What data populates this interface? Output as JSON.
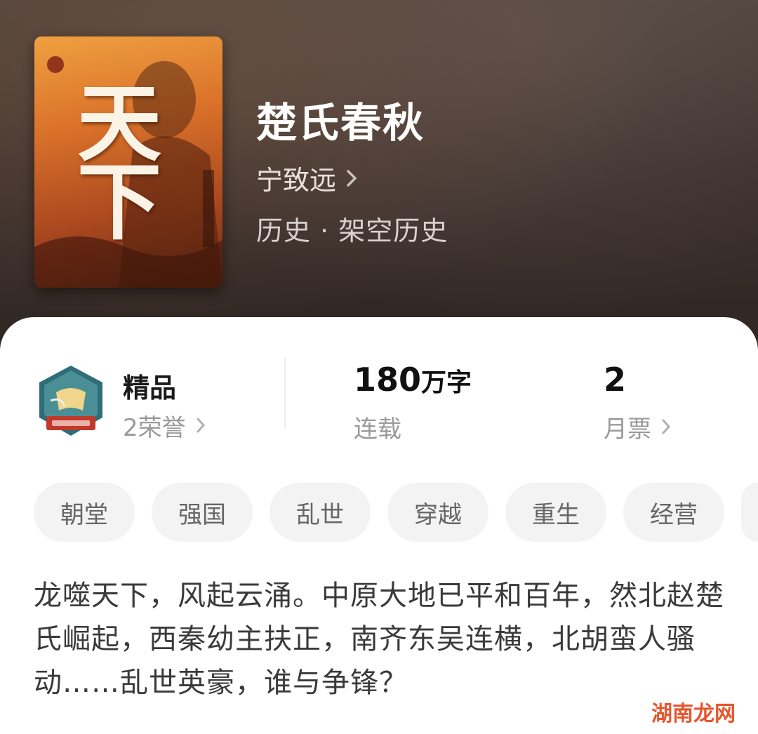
{
  "book": {
    "cover_title": "天下",
    "title": "楚氏春秋",
    "author": "宁致远",
    "genre": "历史 · 架空历史"
  },
  "stats": {
    "badge_title": "精品",
    "badge_sub": "2荣誉",
    "words_num": "180",
    "words_unit": "万字",
    "status": "连载",
    "monthly_votes": "2",
    "monthly_label": "月票"
  },
  "tags": [
    "朝堂",
    "强国",
    "乱世",
    "穿越",
    "重生",
    "经营"
  ],
  "description": "龙噬天下，风起云涌。中原大地已平和百年，然北赵楚氏崛起，西秦幼主扶正，南齐东吴连横，北胡蛮人骚动……乱世英豪，谁与争锋？",
  "watermark": "湖南龙网",
  "colors": {
    "accent_orange": "#e4572e",
    "hero_bg": "#3a2f2b",
    "tag_bg": "#f3f3f3"
  }
}
